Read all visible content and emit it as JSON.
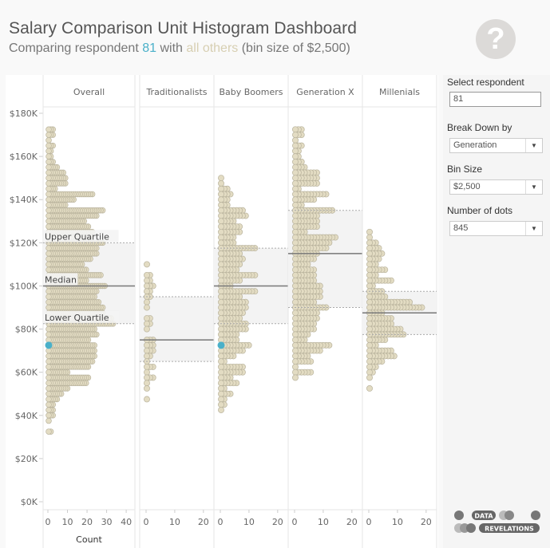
{
  "header": {
    "title": "Salary Comparison Unit Histogram Dashboard",
    "subtitle_prefix": "Comparing respondent ",
    "subtitle_respondent": "81",
    "subtitle_mid": " with ",
    "subtitle_others": "all others",
    "subtitle_suffix": " (bin size of $2,500)",
    "help_icon": "?"
  },
  "colors": {
    "dot": "#e3dcc3",
    "dot_stroke": "#b9b39d",
    "highlight": "#4ab0c9",
    "band": "#f3f3f3",
    "median": "#777777",
    "quartile": "#aaaaaa"
  },
  "controls": {
    "respondent_label": "Select respondent",
    "respondent_value": "81",
    "breakdown_label": "Break Down by",
    "breakdown_value": "Generation",
    "bin_label": "Bin Size",
    "bin_value": "$2,500",
    "dots_label": "Number of dots",
    "dots_value": "845"
  },
  "logo": {
    "line1": "DATA",
    "line2": "REVELATIONS"
  },
  "chart_data": {
    "type": "scatter",
    "subtype": "unit-histogram",
    "ylabel": "",
    "y_ticks": [
      "$180K",
      "$160K",
      "$140K",
      "$120K",
      "$100K",
      "$80K",
      "$60K",
      "$40K",
      "$20K",
      "$0K"
    ],
    "y_tick_values": [
      180,
      160,
      140,
      120,
      100,
      80,
      60,
      40,
      20,
      0
    ],
    "ylim": [
      0,
      180
    ],
    "bin_size_k": 2.5,
    "annotations": [
      "Upper Quartile",
      "Median",
      "Lower Quartile"
    ],
    "highlight_value_k": 72.5,
    "panels": [
      {
        "name": "Overall",
        "xlabel": "Count",
        "x_ticks": [
          "0",
          "10",
          "20",
          "30",
          "40"
        ],
        "x_tick_values": [
          0,
          10,
          20,
          30,
          40
        ],
        "xlim": [
          0,
          42
        ],
        "top_bin_k": 172.5,
        "counts": [
          3,
          3,
          1,
          3,
          2,
          2,
          3,
          5,
          8,
          9,
          9,
          4,
          22,
          13,
          9,
          27,
          24,
          18,
          20,
          22,
          21,
          27,
          24,
          24,
          21,
          17,
          19,
          26,
          19,
          28,
          24,
          23,
          25,
          27,
          27,
          31,
          32,
          23,
          24,
          20,
          23,
          23,
          23,
          22,
          20,
          10,
          20,
          19,
          10,
          7,
          5,
          3,
          3,
          3,
          1,
          0,
          2
        ],
        "upper_quartile_k": 120,
        "median_k": 100,
        "lower_quartile_k": 82.5
      },
      {
        "name": "Traditionalists",
        "xlabel": "",
        "x_ticks": [
          "0",
          "10",
          "20"
        ],
        "x_tick_values": [
          0,
          10,
          20
        ],
        "xlim": [
          0,
          22
        ],
        "top_bin_k": 110,
        "counts": [
          1,
          0,
          2,
          2,
          3,
          2,
          2,
          1,
          1,
          0,
          2,
          2,
          1,
          0,
          3,
          3,
          3,
          2,
          1,
          3,
          1,
          3,
          1,
          1,
          0,
          1
        ],
        "upper_quartile_k": 95,
        "median_k": 75,
        "lower_quartile_k": 65
      },
      {
        "name": "Baby Boomers",
        "xlabel": "",
        "x_ticks": [
          "0",
          "10",
          "20"
        ],
        "x_tick_values": [
          0,
          10,
          20
        ],
        "xlim": [
          0,
          22
        ],
        "top_bin_k": 150,
        "counts": [
          1,
          1,
          3,
          4,
          3,
          3,
          8,
          9,
          5,
          7,
          7,
          5,
          5,
          12,
          7,
          8,
          7,
          6,
          12,
          7,
          4,
          12,
          7,
          9,
          9,
          8,
          7,
          9,
          9,
          6,
          6,
          10,
          8,
          5,
          2,
          8,
          8,
          4,
          6,
          2,
          4,
          2,
          2,
          1
        ],
        "upper_quartile_k": 117.5,
        "median_k": 100,
        "lower_quartile_k": 82.5
      },
      {
        "name": "Generation X",
        "xlabel": "",
        "x_ticks": [
          "0",
          "10",
          "20"
        ],
        "x_tick_values": [
          0,
          10,
          20
        ],
        "xlim": [
          0,
          22
        ],
        "top_bin_k": 172.5,
        "counts": [
          3,
          3,
          1,
          3,
          2,
          2,
          3,
          4,
          8,
          8,
          8,
          2,
          11,
          7,
          3,
          13,
          8,
          8,
          8,
          4,
          14,
          12,
          11,
          8,
          7,
          5,
          7,
          7,
          7,
          9,
          9,
          9,
          7,
          11,
          8,
          8,
          7,
          7,
          5,
          4,
          12,
          9,
          5,
          6,
          1,
          6,
          1
        ],
        "upper_quartile_k": 135,
        "median_k": 115,
        "lower_quartile_k": 90
      },
      {
        "name": "Millenials",
        "xlabel": "",
        "x_ticks": [
          "0",
          "10",
          "20"
        ],
        "x_tick_values": [
          0,
          10,
          20
        ],
        "xlim": [
          0,
          22
        ],
        "top_bin_k": 125,
        "counts": [
          1,
          1,
          3,
          4,
          5,
          4,
          3,
          6,
          3,
          8,
          2,
          5,
          6,
          14,
          18,
          5,
          8,
          8,
          11,
          12,
          6,
          3,
          8,
          9,
          5,
          3,
          2,
          1,
          0,
          1
        ],
        "upper_quartile_k": 97.5,
        "median_k": 87.5,
        "lower_quartile_k": 77.5
      }
    ],
    "highlight_panels": [
      "Overall",
      "Baby Boomers"
    ]
  }
}
